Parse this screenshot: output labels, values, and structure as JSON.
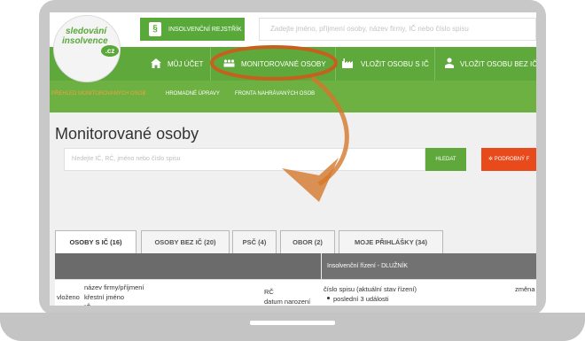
{
  "logo": {
    "line1": "sledování",
    "line2": "insolvence",
    "cz": ".cz"
  },
  "header": {
    "registry_label": "INSOLVENČNÍ REJSTŘÍK",
    "registry_icon": "§",
    "search_placeholder": "Zadejte jméno, příjmení osoby, název firmy, IČ nebo číslo spisu"
  },
  "nav": {
    "items": [
      {
        "label": "MŮJ ÚČET",
        "icon": "home-icon"
      },
      {
        "label": "MONITOROVANÉ OSOBY",
        "icon": "people-icon"
      },
      {
        "label": "VLOŽIT OSOBU S IČ",
        "icon": "factory-icon"
      },
      {
        "label": "VLOŽIT OSOBU BEZ IČ",
        "icon": "person-icon"
      }
    ]
  },
  "subnav": {
    "items": [
      {
        "label": "PŘEHLED MONITOROVANÝCH OSOB",
        "active": true
      },
      {
        "label": "HROMADNÉ ÚPRAVY",
        "active": false
      },
      {
        "label": "FRONTA NAHRÁVANÝCH OSOB",
        "active": false
      }
    ]
  },
  "main": {
    "title": "Monitorované osoby",
    "search_placeholder": "hledejte IČ, RČ, jméno nebo číslo spisu",
    "search_button": "HLEDAT",
    "detail_button": "PODROBNÝ F",
    "detail_icon": "gear-icon"
  },
  "tabs": [
    {
      "label": "OSOBY S IČ (16)",
      "active": true
    },
    {
      "label": "OSOBY BEZ IČ (20)",
      "active": false
    },
    {
      "label": "PSČ (4)",
      "active": false
    },
    {
      "label": "OBOR (2)",
      "active": false
    },
    {
      "label": "MOJE PŘIHLÁŠKY (34)",
      "active": false
    }
  ],
  "table": {
    "group_header": "Insolvenční řízení - DLUŽNÍK",
    "columns": {
      "inserted": "vloženo",
      "name_line1": "název firmy/příjmení",
      "name_line2": "křestní jméno",
      "name_line3": "IČ",
      "rc_line1": "RČ",
      "rc_line2": "datum narození",
      "spis_line1": "číslo spisu (aktuální stav řízení)",
      "spis_bullet": "poslední 3 události",
      "change": "změna"
    }
  },
  "colors": {
    "brand_green": "#5fa83b",
    "subnav_green": "#6db143",
    "accent_orange": "#e84a1b",
    "highlight_ring": "#c4611e"
  }
}
